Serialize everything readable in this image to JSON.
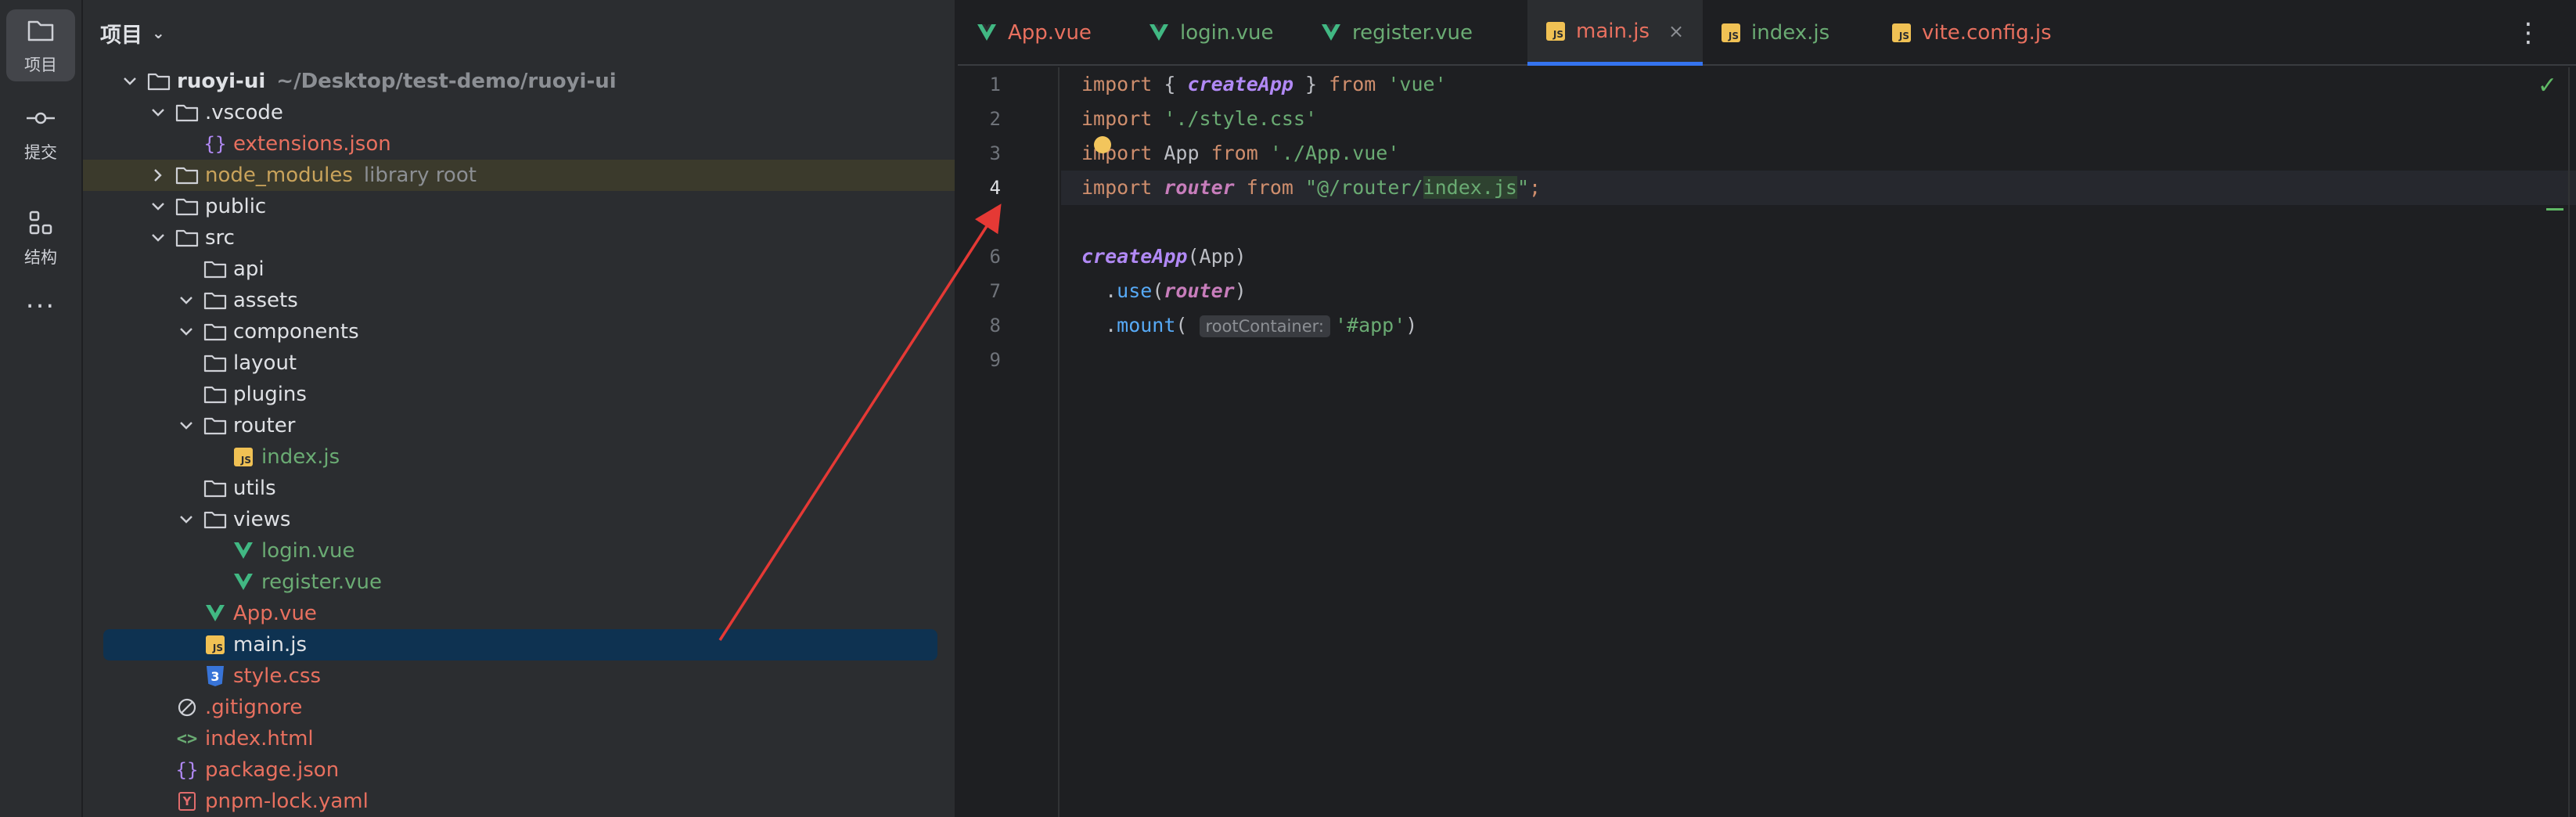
{
  "activity": {
    "project_label": "项目",
    "commit_label": "提交",
    "structure_label": "结构",
    "more_label": "..."
  },
  "project_panel": {
    "title": "项目",
    "tree": [
      {
        "label": "ruoyi-ui",
        "hint": "~/Desktop/test-demo/ruoyi-ui",
        "icon": "folder-icon",
        "indent": 0,
        "expanded": true,
        "color": "folder",
        "bold": true
      },
      {
        "label": ".vscode",
        "indent": 1,
        "expanded": true,
        "icon": "folder-icon",
        "color": "folder"
      },
      {
        "label": "extensions.json",
        "indent": 2,
        "icon": "json-icon",
        "color": "red"
      },
      {
        "label": "node_modules",
        "hint": "library root",
        "indent": 1,
        "expanded": false,
        "icon": "folder-icon",
        "color": "yellow",
        "highlight": true
      },
      {
        "label": "public",
        "indent": 1,
        "expanded": true,
        "icon": "folder-icon",
        "color": "folder"
      },
      {
        "label": "src",
        "indent": 1,
        "expanded": true,
        "icon": "folder-icon",
        "color": "folder"
      },
      {
        "label": "api",
        "indent": 2,
        "icon": "folder-icon",
        "color": "folder"
      },
      {
        "label": "assets",
        "indent": 2,
        "expanded": true,
        "icon": "folder-icon",
        "color": "folder"
      },
      {
        "label": "components",
        "indent": 2,
        "expanded": true,
        "icon": "folder-icon",
        "color": "folder"
      },
      {
        "label": "layout",
        "indent": 2,
        "icon": "folder-icon",
        "color": "folder"
      },
      {
        "label": "plugins",
        "indent": 2,
        "icon": "folder-icon",
        "color": "folder"
      },
      {
        "label": "router",
        "indent": 2,
        "expanded": true,
        "icon": "folder-icon",
        "color": "folder"
      },
      {
        "label": "index.js",
        "indent": 3,
        "icon": "js-icon",
        "color": "green"
      },
      {
        "label": "utils",
        "indent": 2,
        "icon": "folder-icon",
        "color": "folder"
      },
      {
        "label": "views",
        "indent": 2,
        "expanded": true,
        "icon": "folder-icon",
        "color": "folder"
      },
      {
        "label": "login.vue",
        "indent": 3,
        "icon": "vue-icon",
        "color": "green"
      },
      {
        "label": "register.vue",
        "indent": 3,
        "icon": "vue-icon",
        "color": "green"
      },
      {
        "label": "App.vue",
        "indent": 2,
        "icon": "vue-icon",
        "color": "red"
      },
      {
        "label": "main.js",
        "indent": 2,
        "icon": "js-icon",
        "color": "folder",
        "selected": true
      },
      {
        "label": "style.css",
        "indent": 2,
        "icon": "css-icon",
        "color": "red"
      },
      {
        "label": ".gitignore",
        "indent": 1,
        "icon": "ignore-icon",
        "color": "red"
      },
      {
        "label": "index.html",
        "indent": 1,
        "icon": "html-icon",
        "color": "red"
      },
      {
        "label": "package.json",
        "indent": 1,
        "icon": "json-icon",
        "color": "red"
      },
      {
        "label": "pnpm-lock.yaml",
        "indent": 1,
        "icon": "yaml-icon",
        "color": "red"
      }
    ]
  },
  "tabs": [
    {
      "label": "App.vue",
      "icon": "vue-icon",
      "color": "red"
    },
    {
      "label": "login.vue",
      "icon": "vue-icon",
      "color": "green"
    },
    {
      "label": "register.vue",
      "icon": "vue-icon",
      "color": "green"
    },
    {
      "label": "main.js",
      "icon": "js-icon",
      "color": "red",
      "active": true,
      "close": "×"
    },
    {
      "label": "index.js",
      "icon": "js-icon",
      "color": "green"
    },
    {
      "label": "vite.config.js",
      "icon": "js-icon",
      "color": "red"
    }
  ],
  "editor": {
    "line_numbers": [
      "1",
      "2",
      "3",
      "4",
      "6",
      "7",
      "8",
      "9"
    ],
    "current_line": "4",
    "inlay_hint": "rootContainer:",
    "code": {
      "l1": {
        "kw1": "import",
        "p1": " { ",
        "fn": "createApp",
        "p2": " } ",
        "kw2": "from",
        "str": " 'vue'"
      },
      "l2": {
        "kw1": "import",
        "str": " './style.css'"
      },
      "l3": {
        "kw1": "import",
        "p1": " App ",
        "kw2": "from",
        "str": " './App.vue'"
      },
      "l4": {
        "kw1": "import",
        "var": "router",
        "kw2": "from",
        "str1": " \"@/router/",
        "strhl": "index.js",
        "str2": "\"",
        "semi": ";"
      },
      "l6": {
        "fn": "createApp",
        "p1": "(App)"
      },
      "l7": {
        "p1": "  .",
        "meth": "use",
        "p2": "(",
        "var": "router",
        "p3": ")"
      },
      "l8": {
        "p1": "  .",
        "meth": "mount",
        "p2": "( ",
        "str": "'#app'",
        "p3": ")"
      }
    }
  },
  "colors": {
    "accent": "#3574f0",
    "arrow": "#e53935",
    "selection": "#0e3251"
  }
}
